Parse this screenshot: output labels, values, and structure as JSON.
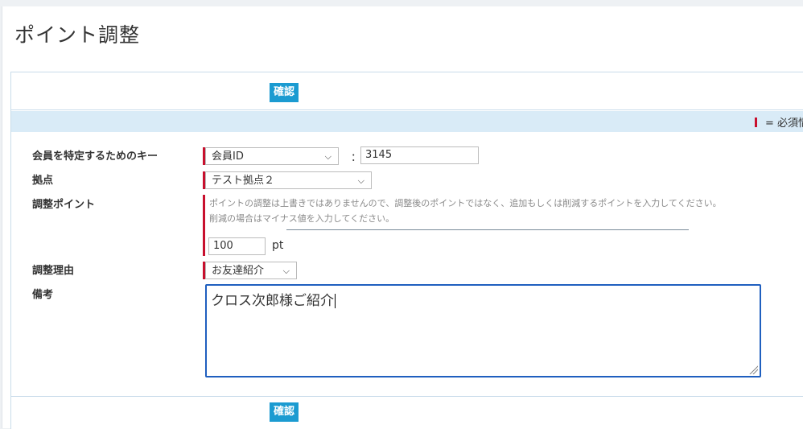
{
  "page": {
    "title": "ポイント調整"
  },
  "actions": {
    "confirm_top": "確認",
    "confirm_bottom": "確認"
  },
  "required_note": "= 必須情報",
  "form": {
    "member_key": {
      "label": "会員を特定するためのキー",
      "type_value": "会員ID",
      "separator": "：",
      "value": "3145"
    },
    "base": {
      "label": "拠点",
      "value": "テスト拠点２"
    },
    "points": {
      "label": "調整ポイント",
      "hint1": "ポイントの調整は上書きではありませんので、調整後のポイントではなく、追加もしくは削減するポイントを入力してください。",
      "hint2": "削減の場合はマイナス値を入力してください。",
      "value": "100",
      "unit": "pt"
    },
    "reason": {
      "label": "調整理由",
      "value": "お友達紹介"
    },
    "notes": {
      "label": "備考",
      "value": "クロス次郎様ご紹介"
    }
  },
  "colors": {
    "accent": "#1b9bd1",
    "required": "#c8102e",
    "band": "#d9ebf7",
    "focus": "#1f5fbf"
  }
}
